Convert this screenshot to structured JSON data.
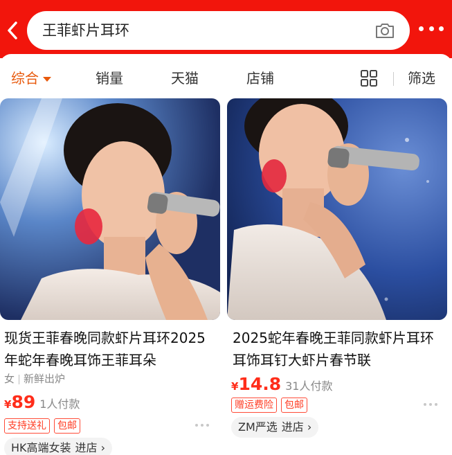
{
  "header": {
    "search_query": "王菲虾片耳环"
  },
  "filters": {
    "items": [
      "综合",
      "销量",
      "天猫",
      "店铺"
    ],
    "filter_label": "筛选"
  },
  "products": [
    {
      "title": "现货王菲春晚同款虾片耳环2025年蛇年春晚耳饰王菲耳朵",
      "tags": [
        "女",
        "新鲜出炉"
      ],
      "currency": "¥",
      "price": "89",
      "sold": "1人付款",
      "badges": [
        "支持送礼",
        "包邮"
      ],
      "store": "HK高端女装",
      "store_enter": "进店 ›"
    },
    {
      "title": "2025蛇年春晚王菲同款虾片耳环耳饰耳钉大虾片春节联",
      "currency": "¥",
      "price": "14.8",
      "sold": "31人付款",
      "badges": [
        "赠运费险",
        "包邮"
      ],
      "store": "ZM严选",
      "store_enter": "进店 ›"
    }
  ],
  "colors": {
    "header_red": "#f2150c",
    "accent_orange": "#e8590c",
    "price_red": "#ff2d1a"
  }
}
